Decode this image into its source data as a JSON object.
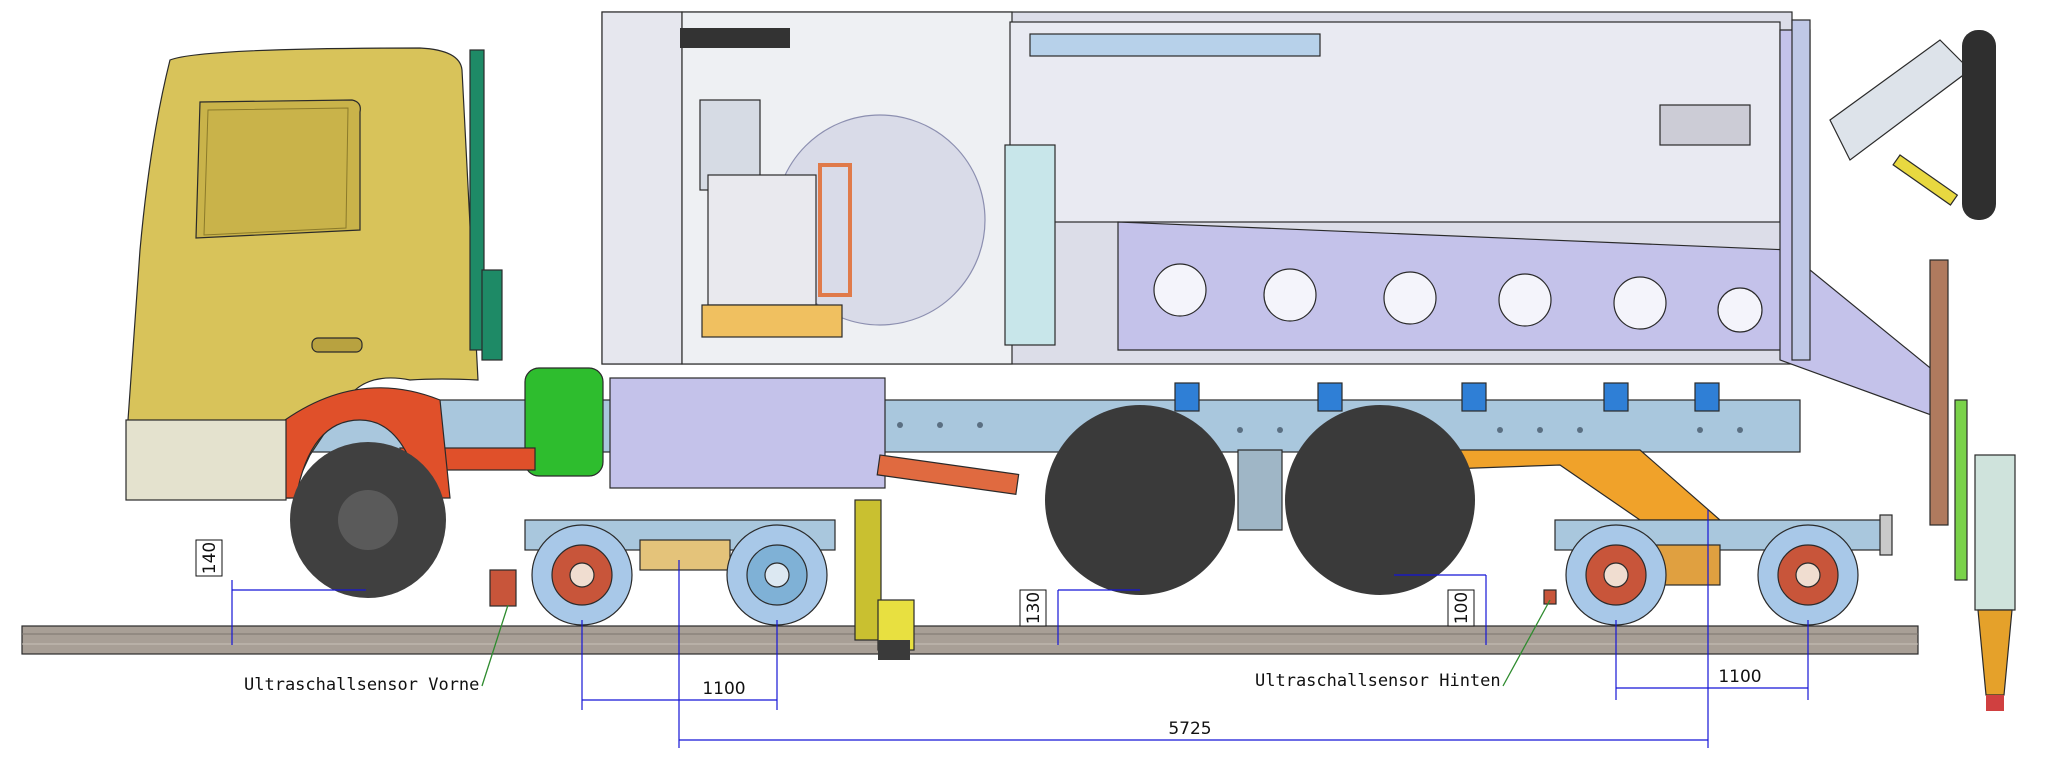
{
  "annotations": {
    "sensor_front": "Ultraschallsensor Vorne",
    "sensor_rear": "Ultraschallsensor Hinten"
  },
  "dimensions": {
    "front_height": "140",
    "mid_height": "130",
    "rear_height": "100",
    "front_wheelbase": "1100",
    "rear_wheelbase": "1100",
    "bogie_spacing": "5725"
  },
  "colors": {
    "cab": "#d8c35a",
    "body_panel": "#c4c2ea",
    "frame": "#a9c7dd",
    "rail": "#a89f96",
    "tire": "#404040",
    "dimension_line": "#1515d6",
    "wheel_hub": "#c8553a"
  }
}
